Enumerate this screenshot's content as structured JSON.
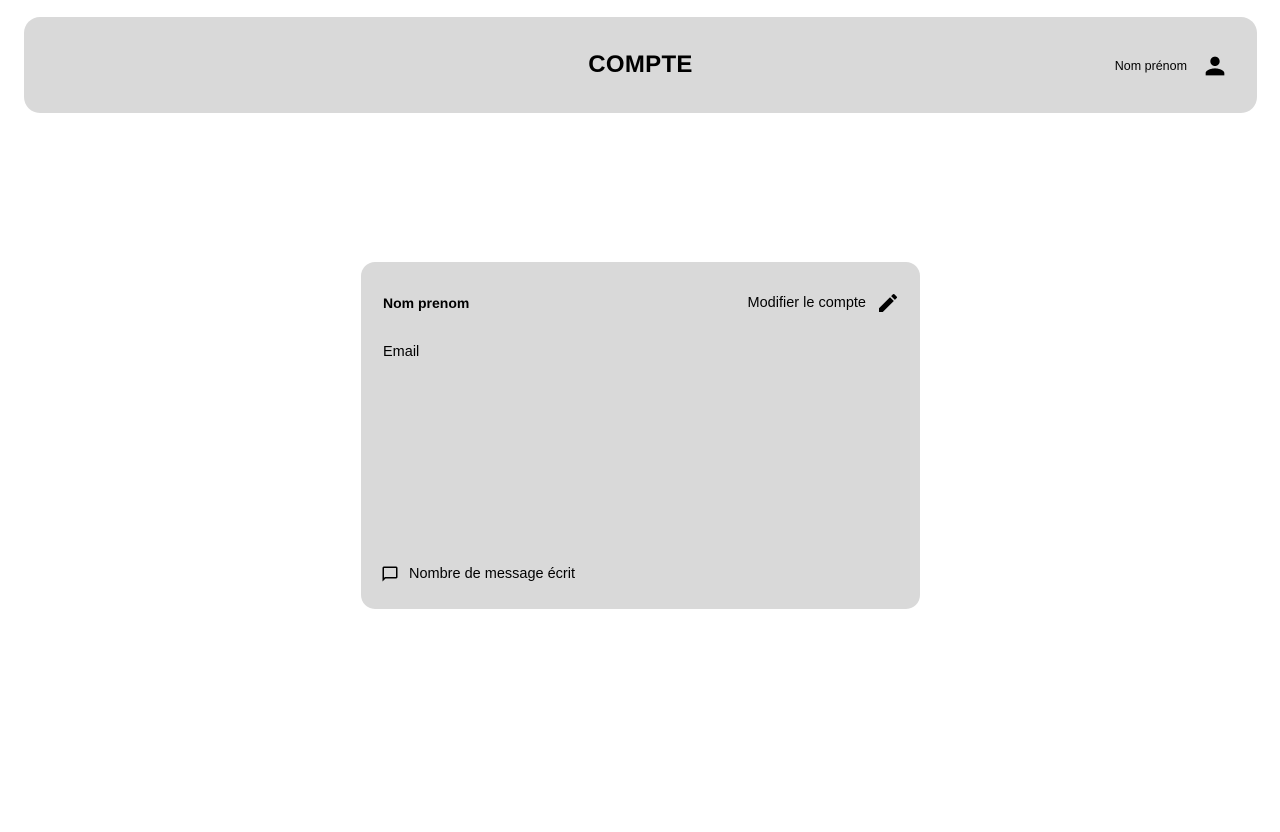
{
  "header": {
    "title": "COMPTE",
    "user_name": "Nom prénom",
    "user_icon": "person-icon"
  },
  "account_card": {
    "name": "Nom prenom",
    "edit_label": "Modifier le compte",
    "edit_icon": "pencil-icon",
    "email_label": "Email",
    "messages_label": "Nombre de message écrit",
    "messages_icon": "chat-bubble-icon"
  },
  "colors": {
    "panel_background": "#d9d9d9",
    "page_background": "#ffffff",
    "text": "#000000"
  }
}
